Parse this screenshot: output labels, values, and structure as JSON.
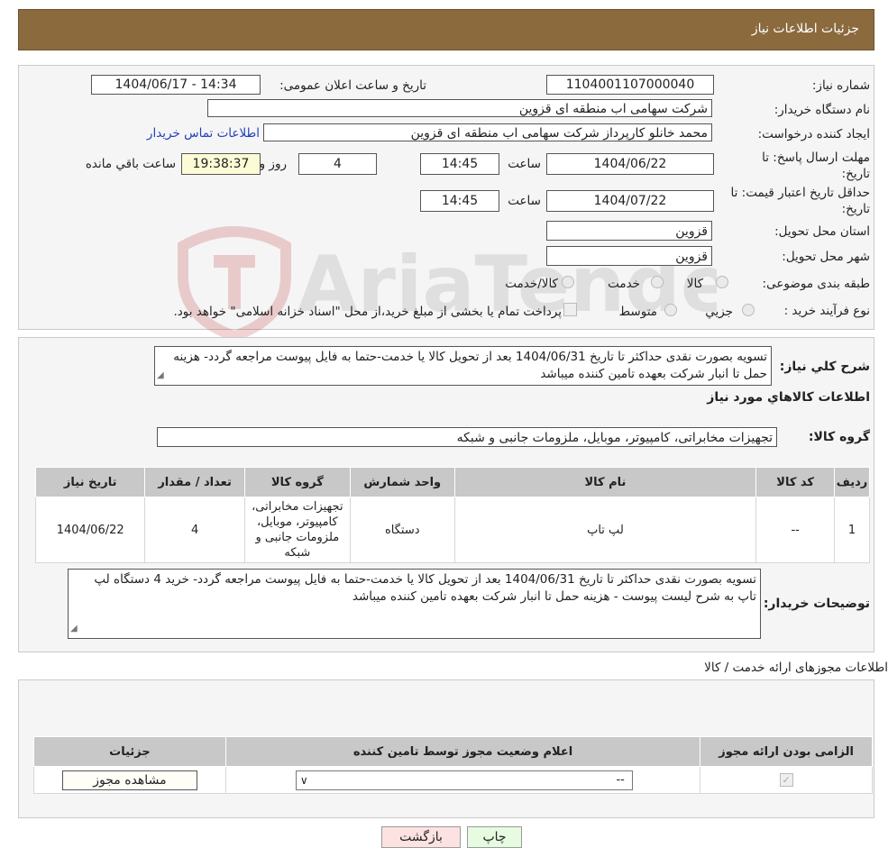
{
  "header": {
    "title": "جزئیات اطلاعات نیاز"
  },
  "form": {
    "need_number_label": "شماره نیاز:",
    "need_number": "1104001107000040",
    "announce_label": "تاریخ و ساعت اعلان عمومی:",
    "announce_value": "1404/06/17 - 14:34",
    "buyer_org_label": "نام دستگاه خریدار:",
    "buyer_org": "شرکت سهامی اب منطقه ای قزوین",
    "creator_label": "ایجاد کننده درخواست:",
    "creator": "محمد خانلو کارپرداز شرکت سهامی اب منطقه ای قزوین",
    "contact_link": "اطلاعات تماس خریدار",
    "deadline_label_1": "مهلت ارسال پاسخ: تا",
    "deadline_label_2": "تاریخ:",
    "deadline_date": "1404/06/22",
    "time_label": "ساعت",
    "deadline_time": "14:45",
    "days_value": "4",
    "days_label": "روز و",
    "remaining_time": "19:38:37",
    "remaining_label": "ساعت باقي مانده",
    "validity_label_1": "حداقل تاریخ اعتبار قیمت: تا",
    "validity_label_2": "تاریخ:",
    "validity_date": "1404/07/22",
    "validity_time": "14:45",
    "province_label": "استان محل تحویل:",
    "province": "قزوین",
    "city_label": "شهر محل تحویل:",
    "city": "قزوین",
    "category_label": "طبقه بندی موضوعی:",
    "category_options": [
      "کالا",
      "خدمت",
      "کالا/خدمت"
    ],
    "process_label": "نوع فرآیند خرید :",
    "process_options": [
      "جزیي",
      "متوسط"
    ],
    "process_note": "پرداخت تمام یا بخشی از مبلغ خرید،از محل \"اسناد خزانه اسلامی\" خواهد بود."
  },
  "details": {
    "desc_label": "شرح کلي نياز:",
    "desc_text": "تسویه بصورت نقدی حداکثر تا تاریخ 1404/06/31 بعد از تحویل کالا یا خدمت-حتما به فایل پیوست مراجعه گردد- هزینه حمل تا انبار شرکت بعهده تامین کننده میباشد",
    "goods_section_title": "اطلاعات کالاهاي مورد نياز",
    "goods_group_label": "گروه کالا:",
    "goods_group_value": "تجهیزات مخابراتی، کامپیوتر، موبایل، ملزومات جانبی و شبکه",
    "table_headers": [
      "رديف",
      "کد کالا",
      "نام کالا",
      "واحد شمارش",
      "گروه کالا",
      "تعداد / مقدار",
      "تاریخ نیاز"
    ],
    "table_rows": [
      {
        "row": "1",
        "code": "--",
        "name": "لپ تاپ",
        "unit": "دستگاه",
        "group": "تجهیزات مخابراتی، کامپیوتر، موبایل، ملزومات جانبی و شبکه",
        "qty": "4",
        "date": "1404/06/22"
      }
    ],
    "buyer_notes_label": "توضیحات خریدار:",
    "buyer_notes": "تسویه بصورت نقدی حداکثر تا تاریخ 1404/06/31 بعد از تحویل کالا یا خدمت-حتما به فایل پیوست مراجعه گردد- خرید 4 دستگاه لپ تاپ به شرح لیست پیوست - هزینه حمل تا انبار شرکت بعهده تامین کننده میباشد"
  },
  "permits": {
    "section_title": "اطلاعات مجوزهای ارائه خدمت / کالا",
    "headers": [
      "الزامی بودن ارائه مجوز",
      "اعلام وضعیت مجوز توسط تامین کننده",
      "جزئیات"
    ],
    "select_value": "--",
    "view_button": "مشاهده مجوز"
  },
  "footer": {
    "print_button": "چاپ",
    "back_button": "بازگشت"
  },
  "watermark": {
    "text": "AriaTender.neT"
  },
  "colors": {
    "header_bg": "#8b6a3e",
    "panel_bg": "#f5f5f5",
    "remaining_bg": "#fdfbd6",
    "link": "#1f3fbf",
    "print_bg": "#e6fbe0",
    "back_bg": "#fde2e2"
  }
}
